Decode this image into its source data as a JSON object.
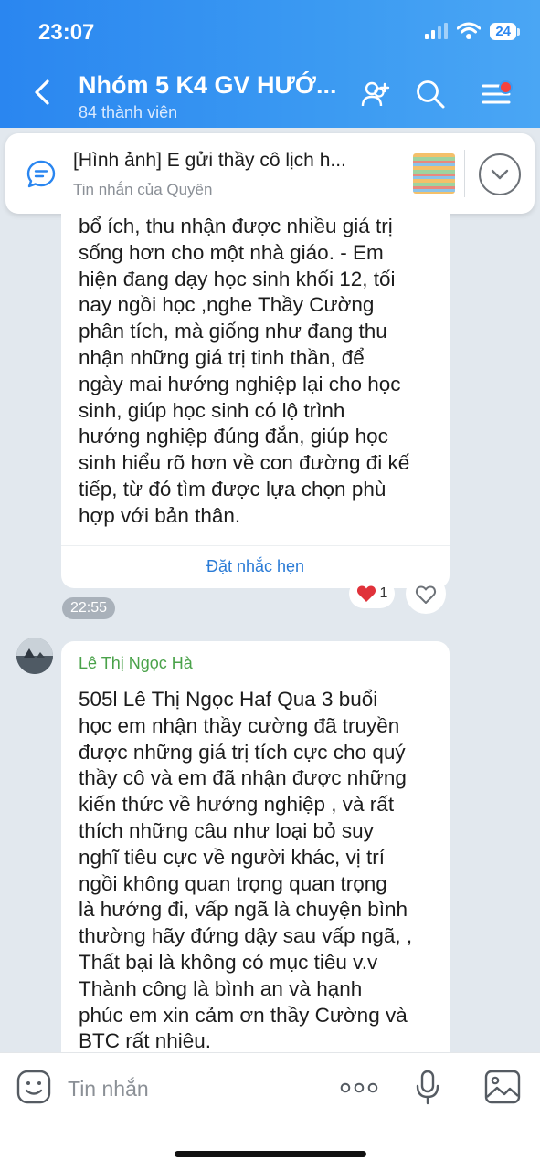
{
  "status": {
    "time": "23:07",
    "battery": "24"
  },
  "header": {
    "title": "Nhóm 5 K4 GV HƯỚ...",
    "subtitle": "84 thành viên"
  },
  "pinned": {
    "title": "[Hình ảnh] E gửi thầy cô lịch h...",
    "subtitle": "Tin nhắn của Quyên"
  },
  "messages": [
    {
      "text": "bổ ích, thu nhận được nhiều giá trị\nsống hơn cho một nhà giáo. - Em\nhiện đang dạy học sinh khối 12, tối\nnay ngồi học ,nghe Thầy Cường\nphân tích, mà giống như đang thu\nnhận những giá trị tinh thần, để\nngày mai hướng nghiệp lại cho học\nsinh, giúp học sinh có lộ trình\nhướng nghiệp đúng đắn, giúp học\nsinh hiểu rõ hơn về con đường đi kế\ntiếp, từ đó tìm được lựa chọn phù\nhợp với bản thân.",
      "reminder_label": "Đặt nhắc hẹn",
      "reaction_count": "1",
      "time": "22:55"
    },
    {
      "sender": "Lê Thị Ngọc Hà",
      "text": "505l Lê Thị Ngọc Haf Qua  3 buổi\nhọc em nhận thầy cường  đã truyền\nđược những giá trị tích cực cho quý\nthầy cô  và em đã nhận được những\nkiến thức về hướng nghiệp , và rất\nthích những  câu  như loại bỏ suy\nnghĩ tiêu cực về người khác, vị trí\nngồi không quan trọng quan trọng\nlà hướng đi, vấp ngã là chuyện  bình\nthường hãy đứng dậy sau vấp ngã, ,\nThất bại là không có mục tiêu v.v\nThành  công là bình an và hạnh\nphúc  em xin cảm ơn thầy Cường và\nBTC rất nhiêu."
    }
  ],
  "input": {
    "placeholder": "Tin nhắn"
  },
  "colors": {
    "header": "#2a86f0",
    "sender_name": "#4aa24a",
    "link": "#2a7bd6"
  }
}
